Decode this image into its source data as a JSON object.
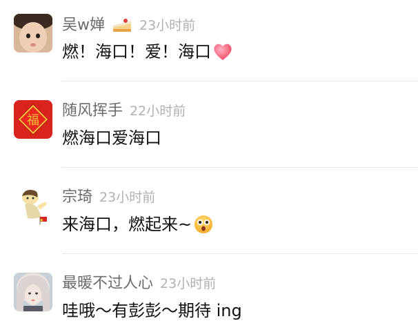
{
  "comments": [
    {
      "author": "吴w婵",
      "badge_icon": "cake-icon",
      "time": "23小时前",
      "text": "燃！海口！爱！海口",
      "emoji": "heart-icon",
      "avatar": "child-photo-avatar"
    },
    {
      "author": "随风挥手",
      "time": "22小时前",
      "text": "燃海口爱海口",
      "avatar": "fu-character-avatar"
    },
    {
      "author": "宗琦",
      "time": "23小时前",
      "text": "来海口，燃起来~",
      "emoji": "surprised-face-icon",
      "avatar": "cartoon-character-avatar"
    },
    {
      "author": "最暖不过人心",
      "time": "23小时前",
      "text": "哇哦～有彭彭～期待 ing",
      "avatar": "girl-photo-avatar"
    }
  ],
  "colors": {
    "author": "#6b6b6b",
    "time": "#b0b0b0",
    "text": "#111111",
    "divider": "#e8e8e8",
    "fu_red": "#d8231f",
    "fu_gold": "#f2c23a"
  }
}
